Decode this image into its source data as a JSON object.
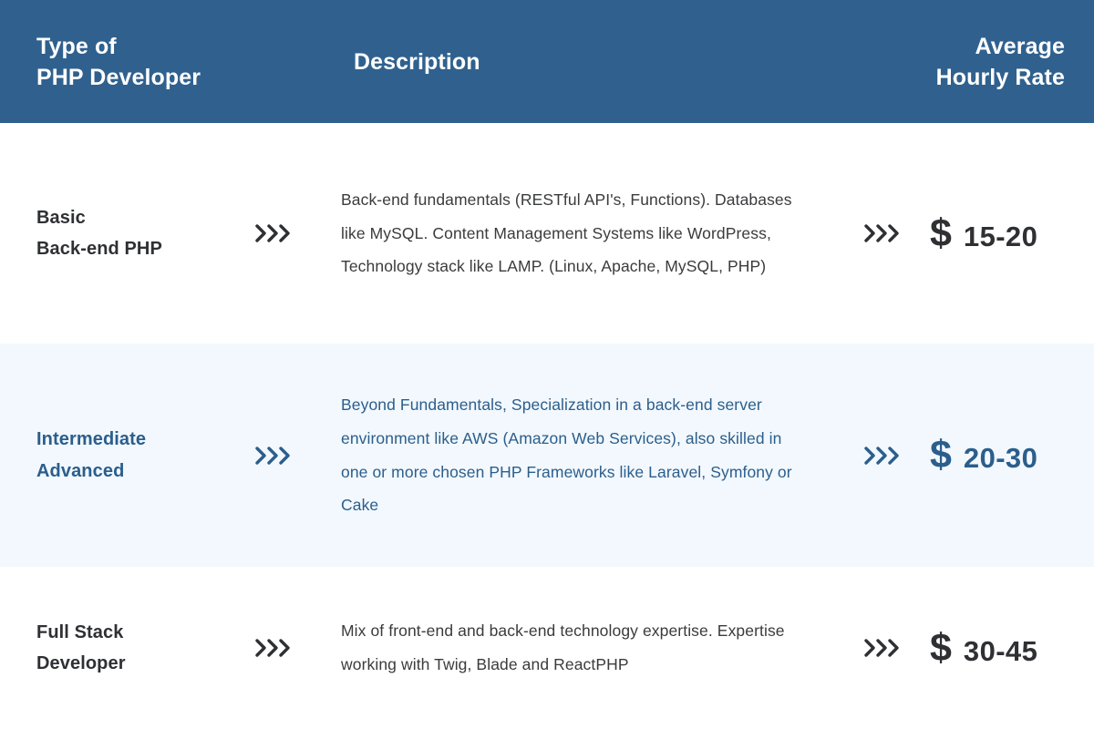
{
  "table": {
    "header": {
      "col_type_line1": "Type of",
      "col_type_line2": "PHP Developer",
      "col_description": "Description",
      "col_rate_line1": "Average",
      "col_rate_line2": "Hourly Rate"
    },
    "rows": [
      {
        "type_line1": "Basic",
        "type_line2": "Back-end PHP",
        "description": "Back-end fundamentals (RESTful API's, Functions). Databases like MySQL. Content Management Systems like WordPress, Technology stack like LAMP. (Linux, Apache, MySQL, PHP)",
        "currency": "$",
        "rate": "15-20",
        "arrow_icon": "triple-chevron-right-icon",
        "highlighted": false
      },
      {
        "type_line1": "Intermediate",
        "type_line2": "Advanced",
        "description": "Beyond Fundamentals, Specialization in a back-end server environment like AWS (Amazon Web Services), also skilled in one or more chosen PHP Frameworks like Laravel, Symfony or Cake",
        "currency": "$",
        "rate": "20-30",
        "arrow_icon": "triple-chevron-right-icon",
        "highlighted": true
      },
      {
        "type_line1": "Full Stack",
        "type_line2": "Developer",
        "description": "Mix of front-end and back-end technology expertise. Expertise working with Twig, Blade and ReactPHP",
        "currency": "$",
        "rate": "30-45",
        "arrow_icon": "triple-chevron-right-icon",
        "highlighted": false
      }
    ]
  },
  "colors": {
    "header_background": "#30618E",
    "highlight_row_background": "#F2F8FD",
    "accent_blue": "#2B5E8C",
    "body_text": "#3A3B3D",
    "header_text": "#FFFFFF"
  }
}
